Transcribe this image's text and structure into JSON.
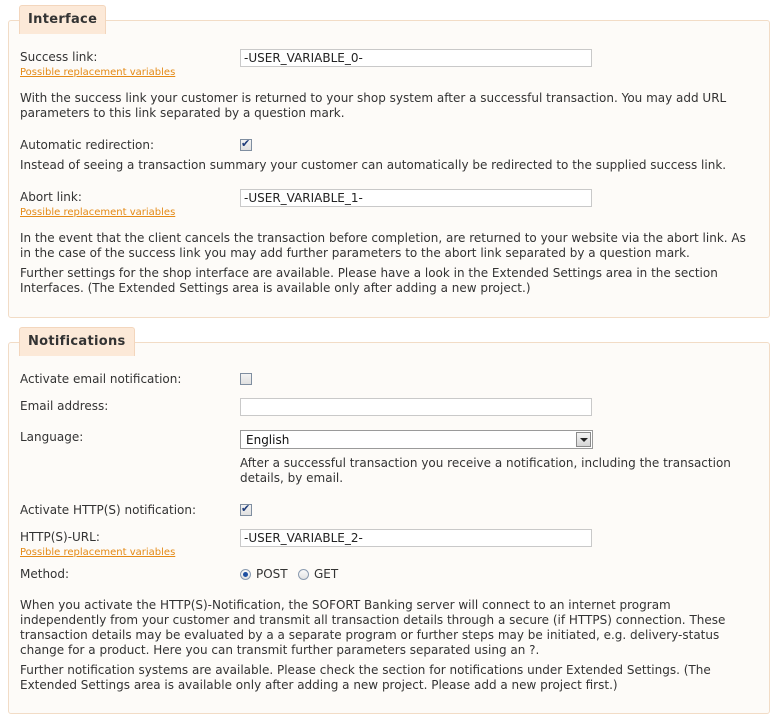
{
  "interface": {
    "legend": "Interface",
    "success_label": "Success link:",
    "success_value": "-USER_VARIABLE_0-",
    "replacement_link": "Possible replacement variables",
    "success_help": "With the success link your customer is returned to your shop system after a successful transaction. You may add URL parameters to this link separated by a question mark.",
    "auto_redirect_label": "Automatic redirection:",
    "auto_redirect_checked": true,
    "auto_redirect_help": "Instead of seeing a transaction summary your customer can automatically be redirected to the supplied success link.",
    "abort_label": "Abort link:",
    "abort_value": "-USER_VARIABLE_1-",
    "abort_help": "In the event that the client cancels the transaction before completion, are returned to your website via the abort link. As in the case of the success link you may add further parameters to the abort link separated by a question mark.",
    "further_help": "Further settings for the shop interface are available. Please have a look in the Extended Settings area in the section Interfaces. (The Extended Settings area is available only after adding a new project.)"
  },
  "notifications": {
    "legend": "Notifications",
    "email_notify_label": "Activate email notification:",
    "email_notify_checked": false,
    "email_label": "Email address:",
    "email_value": "",
    "language_label": "Language:",
    "language_value": "English",
    "language_help": "After a successful transaction you receive a notification, including the transaction details, by email.",
    "http_notify_label": "Activate HTTP(S) notification:",
    "http_notify_checked": true,
    "http_url_label": "HTTP(S)-URL:",
    "http_url_value": "-USER_VARIABLE_2-",
    "replacement_link": "Possible replacement variables",
    "method_label": "Method:",
    "method_post": "POST",
    "method_get": "GET",
    "method_selected": "POST",
    "http_help": "When you activate the HTTP(S)-Notification, the SOFORT Banking server will connect to an internet program independently from your customer and transmit all transaction details through a secure (if HTTPS) connection. These transaction details may be evaluated by a a separate program or further steps may be initiated, e.g. delivery-status change for a product. Here you can transmit further parameters separated using an ?.",
    "further_help": "Further notification systems are available. Please check the section for notifications under Extended Settings. (The Extended Settings area is available only after adding a new project. Please add a new project first.)"
  }
}
